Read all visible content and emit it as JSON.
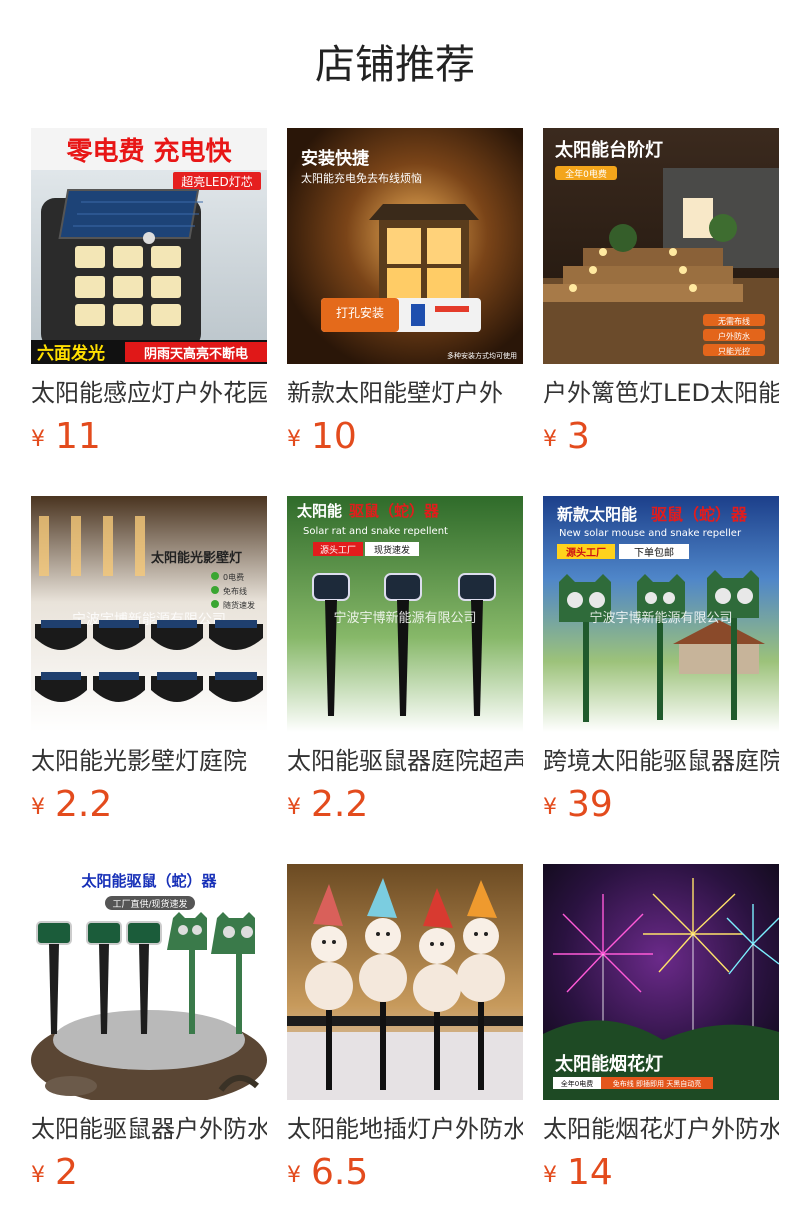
{
  "page": {
    "title": "店铺推荐",
    "currency": "¥"
  },
  "products": [
    {
      "name": "太阳能感应灯户外花园",
      "price": "11",
      "image": {
        "icon": "solar-wall-light-icon",
        "headline": "零电费 充电快",
        "tag": "超亮LED灯芯",
        "footer_left": "六面发光",
        "footer_right": "阴雨天高亮不断电"
      }
    },
    {
      "name": "新款太阳能壁灯户外",
      "price": "10",
      "image": {
        "icon": "solar-lantern-icon",
        "headline": "安装快捷",
        "subline": "太阳能充电免去布线烦恼",
        "tag": "打孔安装",
        "footer": "多种安装方式均可使用"
      }
    },
    {
      "name": "户外篱笆灯LED太阳能",
      "price": "3",
      "image": {
        "icon": "step-light-icon",
        "headline": "太阳能台阶灯",
        "tag": "全年0电费",
        "badges": [
          "无需布线",
          "户外防水",
          "只能光控"
        ]
      }
    },
    {
      "name": "太阳能光影壁灯庭院",
      "price": "2.2",
      "image": {
        "icon": "shadow-wall-light-icon",
        "headline": "太阳能光影壁灯",
        "badges": [
          "0电费",
          "免布线",
          "随货速发"
        ],
        "watermark": "宁波宇博新能源有限公司"
      }
    },
    {
      "name": "太阳能驱鼠器庭院超声波",
      "price": "2.2",
      "image": {
        "icon": "rodent-repeller-icon",
        "headline_a": "太阳能",
        "headline_b": "驱鼠（蛇）器",
        "subline": "Solar rat and snake repellent",
        "tag_a": "源头工厂",
        "tag_b": "现货速发",
        "watermark": "宁波宇博新能源有限公司"
      }
    },
    {
      "name": "跨境太阳能驱鼠器庭院",
      "price": "39",
      "image": {
        "icon": "owl-repeller-icon",
        "headline_a": "新款太阳能",
        "headline_b": "驱鼠（蛇）器",
        "subline": "New solar mouse and snake repeller",
        "tag_a": "源头工厂",
        "tag_b": "下单包邮",
        "watermark": "宁波宇博新能源有限公司"
      }
    },
    {
      "name": "太阳能驱鼠器户外防水",
      "price": "2",
      "image": {
        "icon": "repeller-set-icon",
        "headline": "太阳能驱鼠（蛇）器",
        "tag": "工厂直供/现货速发"
      }
    },
    {
      "name": "太阳能地插灯户外防水",
      "price": "6.5",
      "image": {
        "icon": "snowman-stake-light-icon"
      }
    },
    {
      "name": "太阳能烟花灯户外防水",
      "price": "14",
      "image": {
        "icon": "firework-light-icon",
        "headline": "太阳能烟花灯",
        "tag_a": "全年0电费",
        "tag_b": "免布线 即插即用 天黑自动亮"
      }
    }
  ],
  "colors": {
    "price": "#e34b1d",
    "title": "#222222",
    "name": "#333333"
  }
}
